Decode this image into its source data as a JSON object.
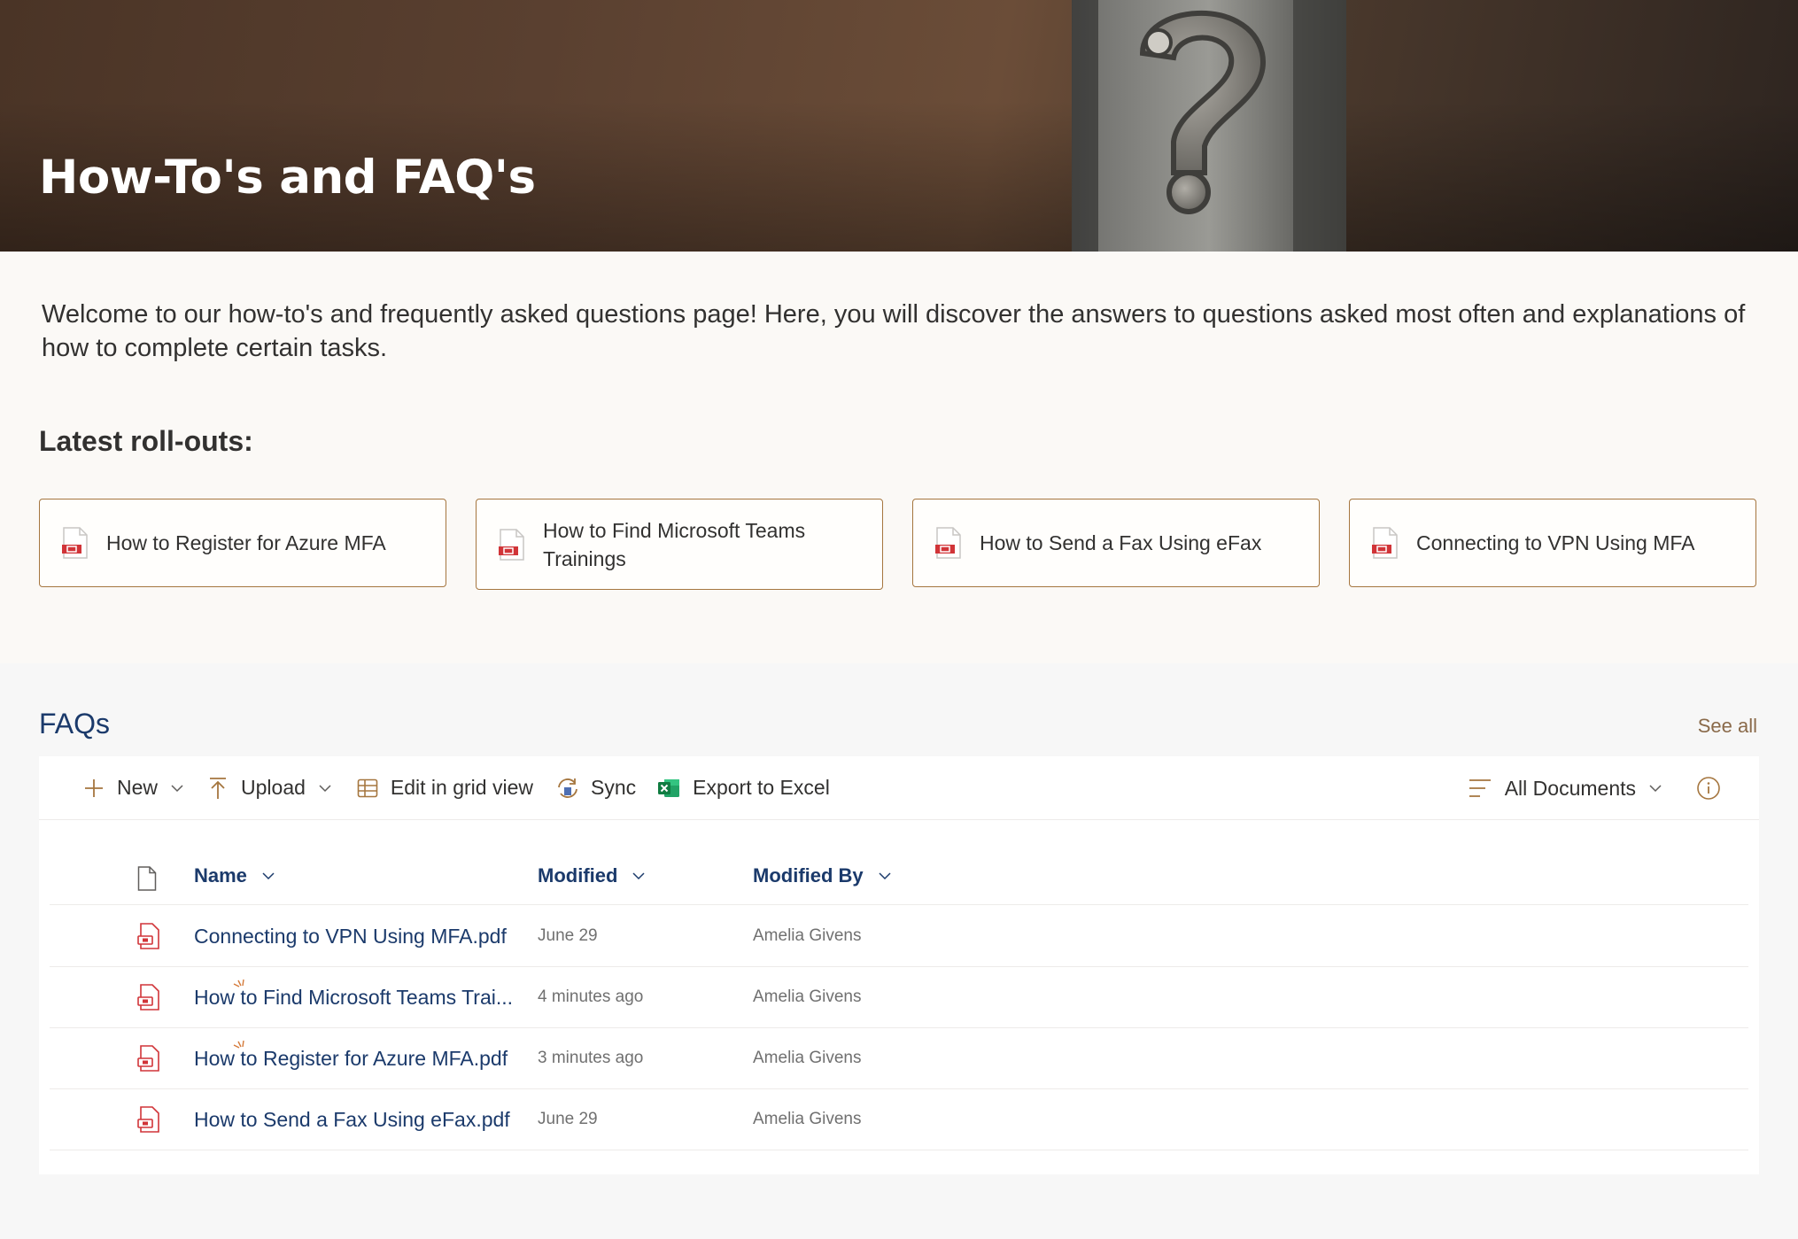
{
  "hero": {
    "title": "How-To's and FAQ's"
  },
  "intro": {
    "welcome_text": "Welcome to our how-to's and frequently asked questions page! Here, you will discover the answers to questions asked most often and explanations of how to complete certain tasks.",
    "latest_heading": "Latest roll-outs:",
    "cards": [
      {
        "label": "How to Register for Azure MFA"
      },
      {
        "label": "How to Find Microsoft Teams Trainings"
      },
      {
        "label": "How to Send a Fax Using eFax"
      },
      {
        "label": "Connecting to VPN Using MFA"
      }
    ]
  },
  "faq": {
    "title": "FAQs",
    "see_all": "See all",
    "toolbar": {
      "new": "New",
      "upload": "Upload",
      "edit_grid": "Edit in grid view",
      "sync": "Sync",
      "export": "Export to Excel",
      "view": "All Documents"
    },
    "columns": {
      "name": "Name",
      "modified": "Modified",
      "modified_by": "Modified By"
    },
    "rows": [
      {
        "name": "Connecting to VPN Using MFA.pdf",
        "modified": "June 29",
        "modified_by": "Amelia Givens",
        "is_new": false
      },
      {
        "name": "How to Find Microsoft Teams Trai...",
        "modified": "4 minutes ago",
        "modified_by": "Amelia Givens",
        "is_new": true
      },
      {
        "name": "How to Register for Azure MFA.pdf",
        "modified": "3 minutes ago",
        "modified_by": "Amelia Givens",
        "is_new": true
      },
      {
        "name": "How to Send a Fax Using eFax.pdf",
        "modified": "June 29",
        "modified_by": "Amelia Givens",
        "is_new": false
      }
    ]
  },
  "colors": {
    "accent_brown": "#a5763f",
    "header_navy": "#1b3a6b",
    "pdf_red": "#d13438"
  }
}
